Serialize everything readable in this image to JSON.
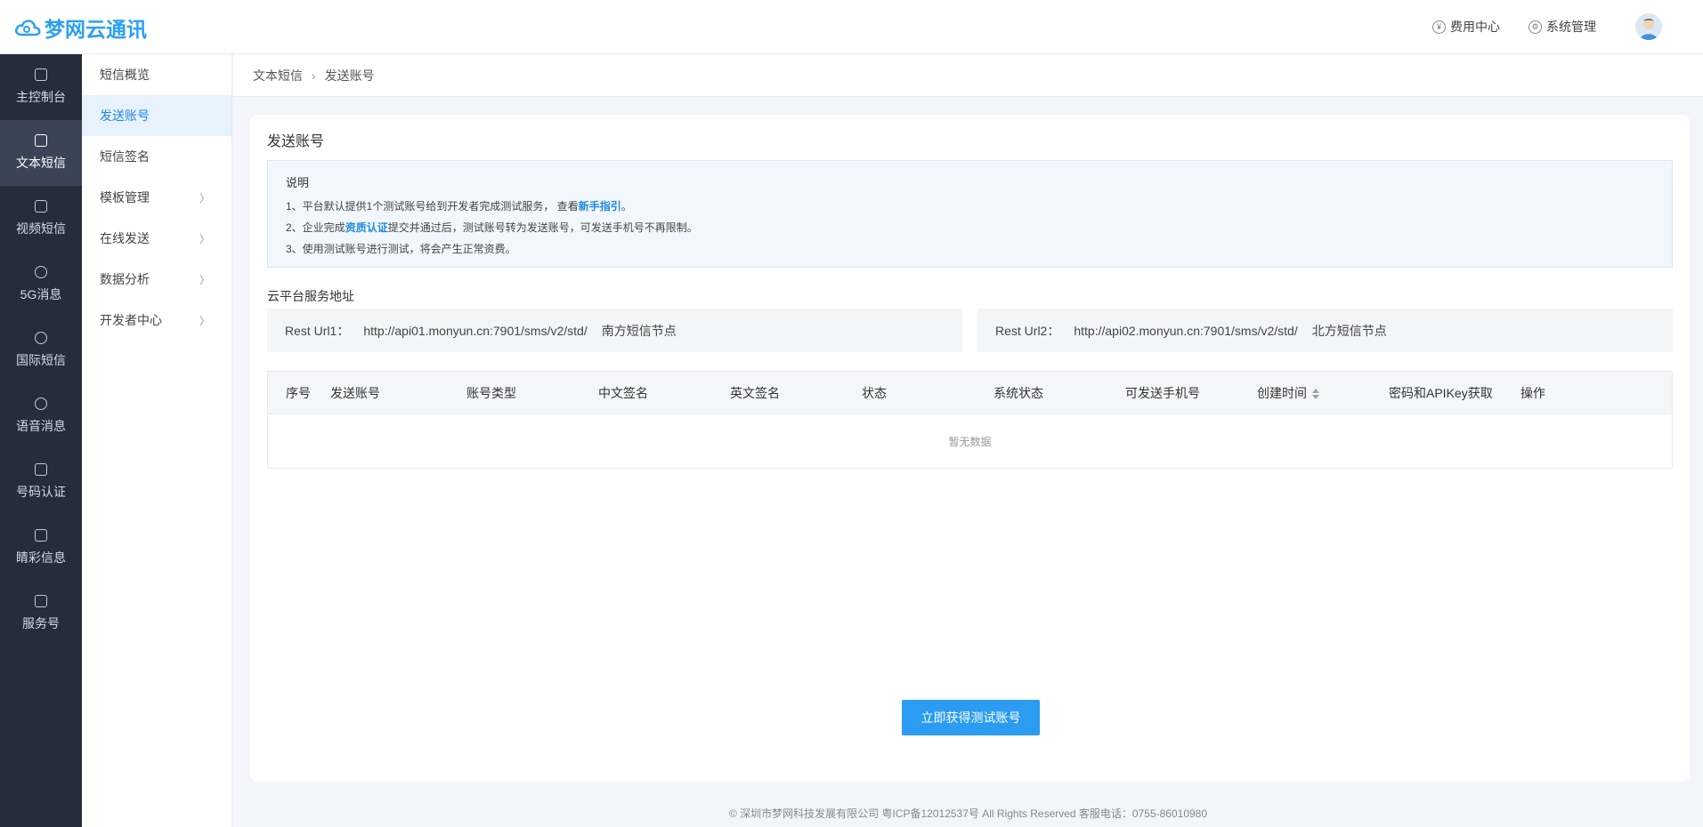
{
  "brand": {
    "name": "梦网云通讯",
    "color": "#2aa0f4"
  },
  "header": {
    "links": [
      {
        "icon": "yen-icon",
        "label": "费用中心"
      },
      {
        "icon": "gear-icon",
        "label": "系统管理"
      }
    ]
  },
  "leftnav": {
    "items": [
      {
        "label": "主控制台",
        "icon": "dashboard-icon",
        "active": false
      },
      {
        "label": "文本短信",
        "icon": "message-icon",
        "active": true
      },
      {
        "label": "视频短信",
        "icon": "video-icon",
        "active": false
      },
      {
        "label": "5G消息",
        "icon": "5g-icon",
        "active": false
      },
      {
        "label": "国际短信",
        "icon": "globe-icon",
        "active": false
      },
      {
        "label": "语音消息",
        "icon": "microphone-icon",
        "active": false
      },
      {
        "label": "号码认证",
        "icon": "shield-icon",
        "active": false
      },
      {
        "label": "睛彩信息",
        "icon": "chat-icon",
        "active": false
      },
      {
        "label": "服务号",
        "icon": "document-icon",
        "active": false
      }
    ]
  },
  "subnav": {
    "items": [
      {
        "label": "短信概览",
        "expandable": false,
        "active": false
      },
      {
        "label": "发送账号",
        "expandable": false,
        "active": true
      },
      {
        "label": "短信签名",
        "expandable": false,
        "active": false
      },
      {
        "label": "模板管理",
        "expandable": true,
        "active": false
      },
      {
        "label": "在线发送",
        "expandable": true,
        "active": false
      },
      {
        "label": "数据分析",
        "expandable": true,
        "active": false
      },
      {
        "label": "开发者中心",
        "expandable": true,
        "active": false
      }
    ]
  },
  "breadcrumb": {
    "parent": "文本短信",
    "current": "发送账号"
  },
  "main": {
    "title": "发送账号",
    "notice": {
      "title": "说明",
      "line1_a": "1、平台默认提供1个测试账号给到开发者完成测试服务， 查看",
      "line1_link": "新手指引",
      "line1_b": "。",
      "line2_a": "2、企业完成",
      "line2_link": "资质认证",
      "line2_b": "提交并通过后，测试账号转为发送账号，可发送手机号不再限制。",
      "line3": "3、使用测试账号进行测试，将会产生正常资费。"
    },
    "service_label": "云平台服务地址",
    "urls": [
      {
        "key": "Rest Url1：",
        "url": "http://api01.monyun.cn:7901/sms/v2/std/",
        "node": "南方短信节点"
      },
      {
        "key": "Rest Url2：",
        "url": "http://api02.monyun.cn:7901/sms/v2/std/",
        "node": "北方短信节点"
      }
    ],
    "table": {
      "columns": [
        "序号",
        "发送账号",
        "账号类型",
        "中文签名",
        "英文签名",
        "状态",
        "系统状态",
        "可发送手机号",
        "创建时间",
        "密码和APIKey获取",
        "操作"
      ],
      "empty_text": "暂无数据"
    },
    "button_label": "立即获得测试账号"
  },
  "footer": "© 深圳市梦网科技发展有限公司 粤ICP备12012537号 All Rights Reserved 客服电话：0755-86010980"
}
